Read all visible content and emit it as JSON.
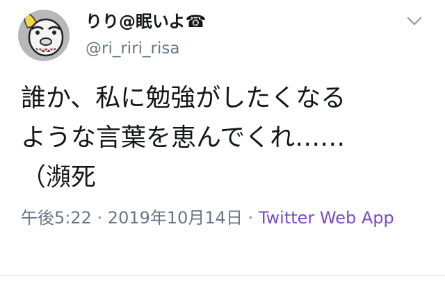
{
  "user": {
    "display_name": "りり@眠いよ☎",
    "handle": "@ri_riri_risa"
  },
  "tweet": {
    "lines": [
      "誰か、私に勉強がしたくなる",
      "ような言葉を恵んでくれ……",
      "（瀕死"
    ],
    "time": "午後5:22",
    "separator1": " · ",
    "date": "2019年10月14日",
    "separator2": " · ",
    "source": "Twitter Web App"
  },
  "icons": {
    "avatar": "gorilla-avatar",
    "menu": "chevron-down-icon"
  },
  "colors": {
    "text": "#14171a",
    "secondary": "#657786",
    "source_link": "#794bc4"
  }
}
